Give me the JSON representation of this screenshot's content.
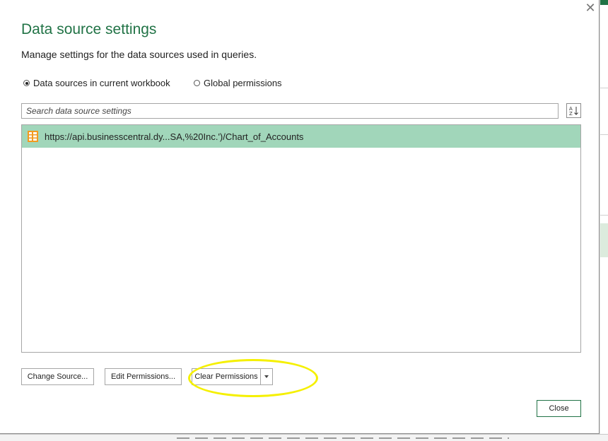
{
  "dialog": {
    "title": "Data source settings",
    "subtitle": "Manage settings for the data sources used in queries."
  },
  "scope": {
    "current_workbook_label": "Data sources in current workbook",
    "global_label": "Global permissions",
    "selected": "current_workbook"
  },
  "search": {
    "placeholder": "Search data source settings",
    "value": ""
  },
  "sources": [
    {
      "url": "https://api.businesscentral.dy...SA,%20Inc.')/Chart_of_Accounts",
      "icon": "table-icon",
      "selected": true
    }
  ],
  "buttons": {
    "change_source": "Change Source...",
    "edit_permissions": "Edit Permissions...",
    "clear_permissions": "Clear Permissions",
    "close": "Close"
  },
  "colors": {
    "accent": "#217346",
    "selection": "#a1d6ba",
    "annotation": "#f5f000"
  }
}
